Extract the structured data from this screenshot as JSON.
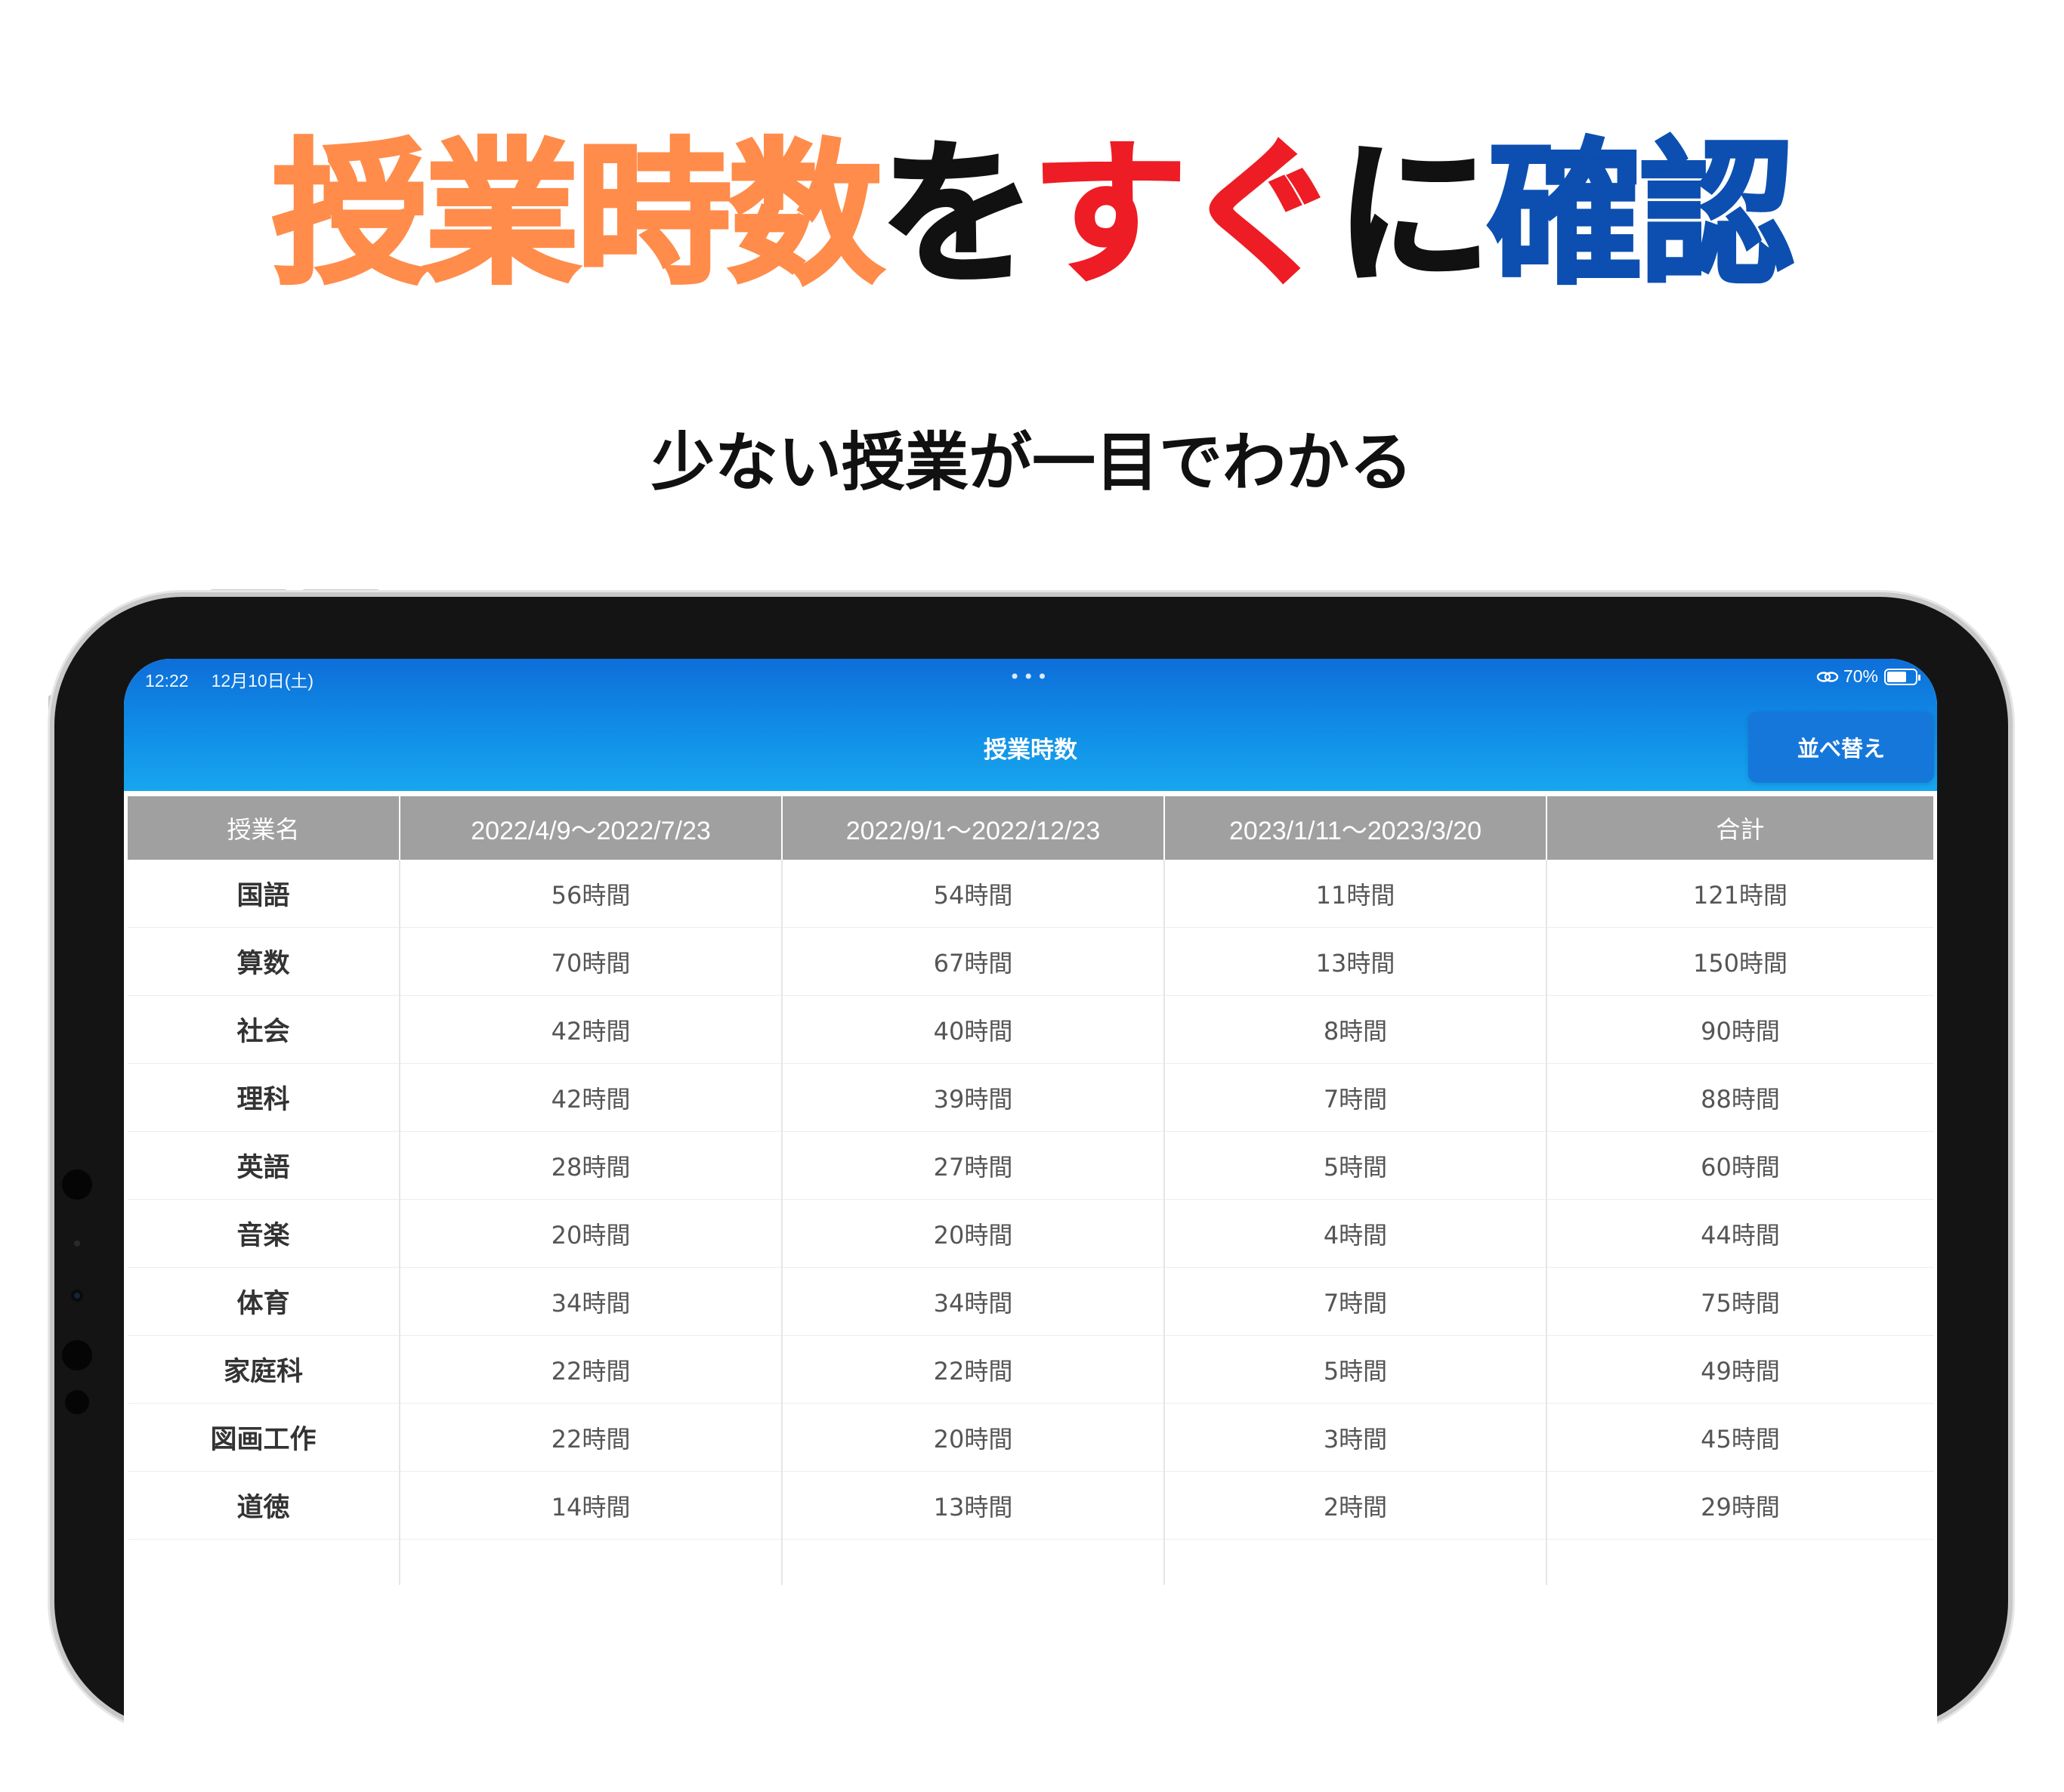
{
  "headline": {
    "segments": [
      {
        "text": "授業時数",
        "color": "#ff8c4a"
      },
      {
        "text": "を",
        "color": "#111111"
      },
      {
        "text": "すぐ",
        "color": "#ee1c24"
      },
      {
        "text": "に",
        "color": "#111111"
      },
      {
        "text": "確認",
        "color": "#0c4fb0"
      }
    ]
  },
  "subheadline": "少ない授業が一目でわかる",
  "status_bar": {
    "time": "12:22",
    "date": "12月10日(土)",
    "battery_percent": "70%",
    "battery_level": 0.7,
    "icons": [
      "link-icon",
      "battery-icon"
    ]
  },
  "nav": {
    "title": "授業時数",
    "sort_button": "並べ替え"
  },
  "theme": {
    "accent": "#108ee6",
    "header_gray": "#a0a0a0"
  },
  "table": {
    "headers": [
      "授業名",
      "2022/4/9〜2022/7/23",
      "2022/9/1〜2022/12/23",
      "2023/1/11〜2023/3/20",
      "合計"
    ],
    "rows": [
      {
        "subject": "国語",
        "values": [
          "56時間",
          "54時間",
          "11時間",
          "121時間"
        ]
      },
      {
        "subject": "算数",
        "values": [
          "70時間",
          "67時間",
          "13時間",
          "150時間"
        ]
      },
      {
        "subject": "社会",
        "values": [
          "42時間",
          "40時間",
          "8時間",
          "90時間"
        ]
      },
      {
        "subject": "理科",
        "values": [
          "42時間",
          "39時間",
          "7時間",
          "88時間"
        ]
      },
      {
        "subject": "英語",
        "values": [
          "28時間",
          "27時間",
          "5時間",
          "60時間"
        ]
      },
      {
        "subject": "音楽",
        "values": [
          "20時間",
          "20時間",
          "4時間",
          "44時間"
        ]
      },
      {
        "subject": "体育",
        "values": [
          "34時間",
          "34時間",
          "7時間",
          "75時間"
        ]
      },
      {
        "subject": "家庭科",
        "values": [
          "22時間",
          "22時間",
          "5時間",
          "49時間"
        ]
      },
      {
        "subject": "図画工作",
        "values": [
          "22時間",
          "20時間",
          "3時間",
          "45時間"
        ]
      },
      {
        "subject": "道徳",
        "values": [
          "14時間",
          "13時間",
          "2時間",
          "29時間"
        ]
      }
    ]
  }
}
